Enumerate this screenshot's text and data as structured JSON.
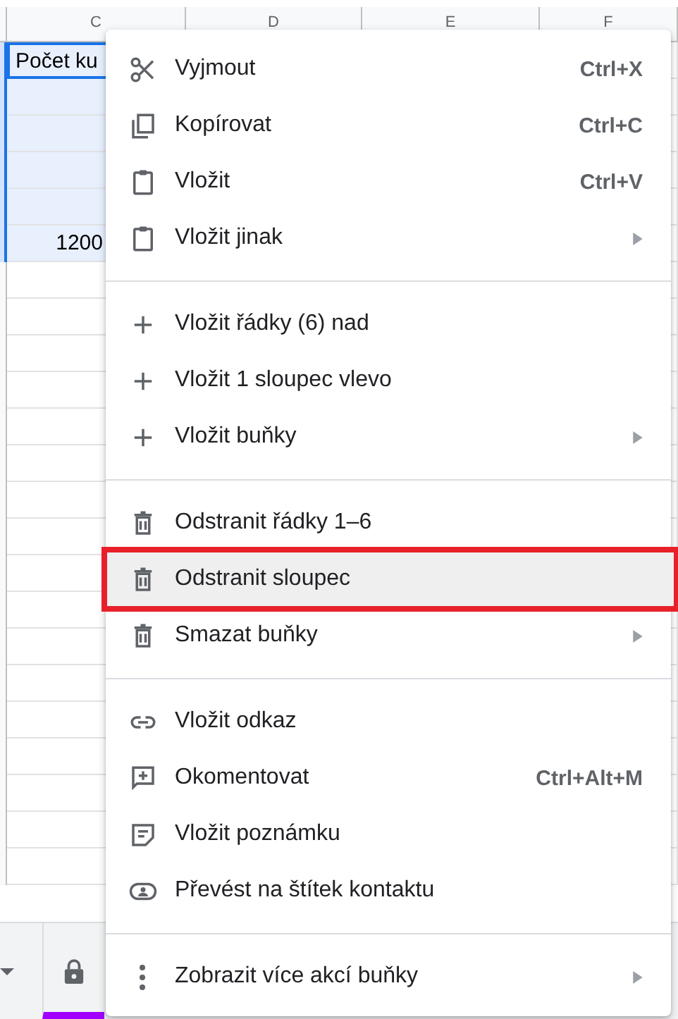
{
  "columns": [
    "C",
    "D",
    "E",
    "F"
  ],
  "cells": [
    {
      "text": "Počet ku",
      "kind": "text",
      "selected": true
    },
    {
      "text": "",
      "kind": "text",
      "selected": true
    },
    {
      "text": "",
      "kind": "text",
      "selected": true
    },
    {
      "text": "",
      "kind": "text",
      "selected": true
    },
    {
      "text": "",
      "kind": "text",
      "selected": true
    },
    {
      "text": "1200",
      "kind": "number",
      "selected": true
    },
    {
      "text": "",
      "kind": "text",
      "selected": false
    }
  ],
  "menu": [
    [
      {
        "kind": "scissors",
        "label": "Vyjmout",
        "shortcut": "Ctrl+X",
        "submenu": false,
        "highlighted": false
      },
      {
        "kind": "copy",
        "label": "Kopírovat",
        "shortcut": "Ctrl+C",
        "submenu": false,
        "highlighted": false
      },
      {
        "kind": "clipboard",
        "label": "Vložit",
        "shortcut": "Ctrl+V",
        "submenu": false,
        "highlighted": false
      },
      {
        "kind": "clipboard",
        "label": "Vložit jinak",
        "submenu": true,
        "highlighted": false
      }
    ],
    [
      {
        "kind": "plus",
        "label": "Vložit řádky (6) nad",
        "submenu": false,
        "highlighted": false
      },
      {
        "kind": "plus",
        "label": "Vložit 1 sloupec vlevo",
        "submenu": false,
        "highlighted": false
      },
      {
        "kind": "plus",
        "label": "Vložit buňky",
        "submenu": true,
        "highlighted": false
      }
    ],
    [
      {
        "kind": "trash",
        "label": "Odstranit řádky 1–6",
        "submenu": false,
        "highlighted": false
      },
      {
        "kind": "trash",
        "label": "Odstranit sloupec",
        "submenu": false,
        "highlighted": true
      },
      {
        "kind": "trash",
        "label": "Smazat buňky",
        "submenu": true,
        "highlighted": false
      }
    ],
    [
      {
        "kind": "link",
        "label": "Vložit odkaz",
        "submenu": false,
        "highlighted": false
      },
      {
        "kind": "comment",
        "label": "Okomentovat",
        "shortcut": "Ctrl+Alt+M",
        "submenu": false,
        "highlighted": false
      },
      {
        "kind": "note",
        "label": "Vložit poznámku",
        "submenu": false,
        "highlighted": false
      },
      {
        "kind": "contact",
        "label": "Převést na štítek kontaktu",
        "submenu": false,
        "highlighted": false
      }
    ],
    [
      {
        "kind": "dots",
        "label": "Zobrazit více akcí buňky",
        "submenu": true,
        "highlighted": false
      }
    ]
  ],
  "sheet_tabs": [
    {
      "locked": true,
      "selected": true
    }
  ]
}
